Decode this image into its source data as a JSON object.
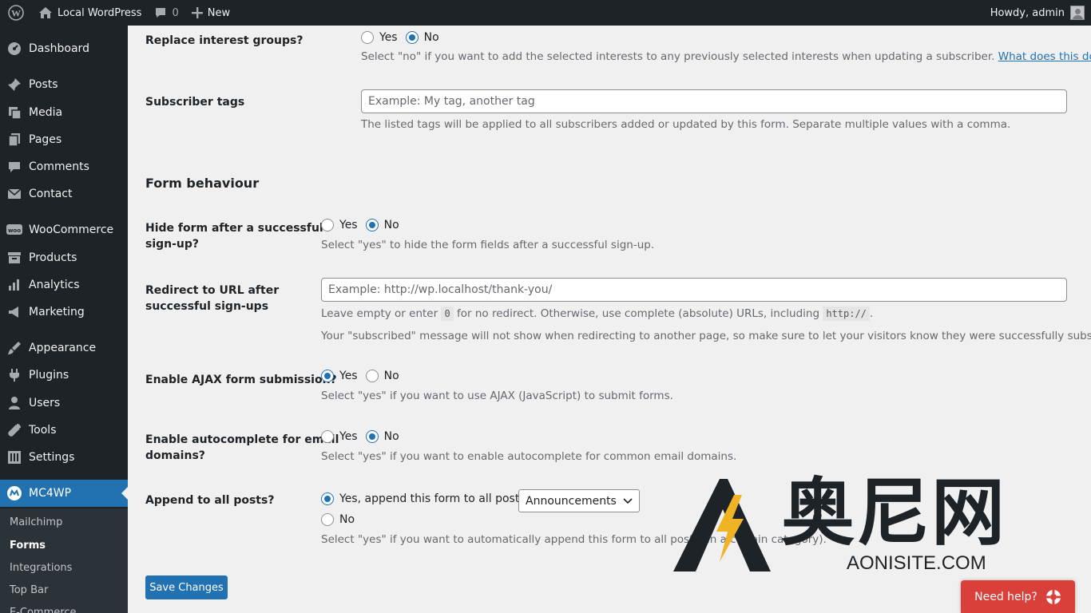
{
  "adminbar": {
    "site_name": "Local WordPress",
    "comments_count": "0",
    "new_label": "New",
    "howdy": "Howdy, admin"
  },
  "sidebar": {
    "items": [
      {
        "label": "Dashboard",
        "icon": "dashboard-icon"
      },
      {
        "label": "Posts",
        "icon": "pin-icon"
      },
      {
        "label": "Media",
        "icon": "media-icon"
      },
      {
        "label": "Pages",
        "icon": "pages-icon"
      },
      {
        "label": "Comments",
        "icon": "comment-icon"
      },
      {
        "label": "Contact",
        "icon": "envelope-icon"
      },
      {
        "label": "WooCommerce",
        "icon": "woo-icon"
      },
      {
        "label": "Products",
        "icon": "archive-icon"
      },
      {
        "label": "Analytics",
        "icon": "bar-chart-icon"
      },
      {
        "label": "Marketing",
        "icon": "megaphone-icon"
      },
      {
        "label": "Appearance",
        "icon": "brush-icon"
      },
      {
        "label": "Plugins",
        "icon": "plug-icon"
      },
      {
        "label": "Users",
        "icon": "users-icon"
      },
      {
        "label": "Tools",
        "icon": "wrench-icon"
      },
      {
        "label": "Settings",
        "icon": "settings-icon"
      },
      {
        "label": "MC4WP",
        "icon": "mc4wp-icon"
      }
    ],
    "submenu": [
      "Mailchimp",
      "Forms",
      "Integrations",
      "Top Bar",
      "E-Commerce"
    ]
  },
  "form": {
    "replace_interest": {
      "label": "Replace interest groups?",
      "yes": "Yes",
      "no": "No",
      "desc": "Select \"no\" if you want to add the selected interests to any previously selected interests when updating a subscriber.",
      "link": "What does this do?"
    },
    "subscriber_tags": {
      "label": "Subscriber tags",
      "placeholder": "Example: My tag, another tag",
      "desc": "The listed tags will be applied to all subscribers added or updated by this form. Separate multiple values with a comma."
    },
    "section_title": "Form behaviour",
    "hide_form": {
      "label_line1": "Hide form after a successful",
      "label_line2": "sign-up?",
      "yes": "Yes",
      "no": "No",
      "desc": "Select \"yes\" to hide the form fields after a successful sign-up."
    },
    "redirect": {
      "label_line1": "Redirect to URL after",
      "label_line2": "successful sign-ups",
      "placeholder": "Example: http://wp.localhost/thank-you/",
      "desc1_a": "Leave empty or enter",
      "desc1_code1": "0",
      "desc1_b": "for no redirect. Otherwise, use complete (absolute) URLs, including",
      "desc1_code2": "http://",
      "desc1_c": ".",
      "desc2": "Your \"subscribed\" message will not show when redirecting to another page, so make sure to let your visitors know they were successfully subscribed."
    },
    "ajax": {
      "label": "Enable AJAX form submission?",
      "yes": "Yes",
      "no": "No",
      "desc": "Select \"yes\" if you want to use AJAX (JavaScript) to submit forms."
    },
    "autocomplete": {
      "label_line1": "Enable autocomplete for email",
      "label_line2": "domains?",
      "yes": "Yes",
      "no": "No",
      "desc": "Select \"yes\" if you want to enable autocomplete for common email domains."
    },
    "append": {
      "label": "Append to all posts?",
      "yes": "Yes, append this form to all posts in",
      "category": "Announcements",
      "no": "No",
      "desc": "Select \"yes\" if you want to automatically append this form to all posts (in a certain category)."
    },
    "save_label": "Save Changes"
  },
  "watermark": {
    "brand": "奥尼网",
    "domain": "AONISITE.COM"
  },
  "help": {
    "label": "Need help?"
  }
}
